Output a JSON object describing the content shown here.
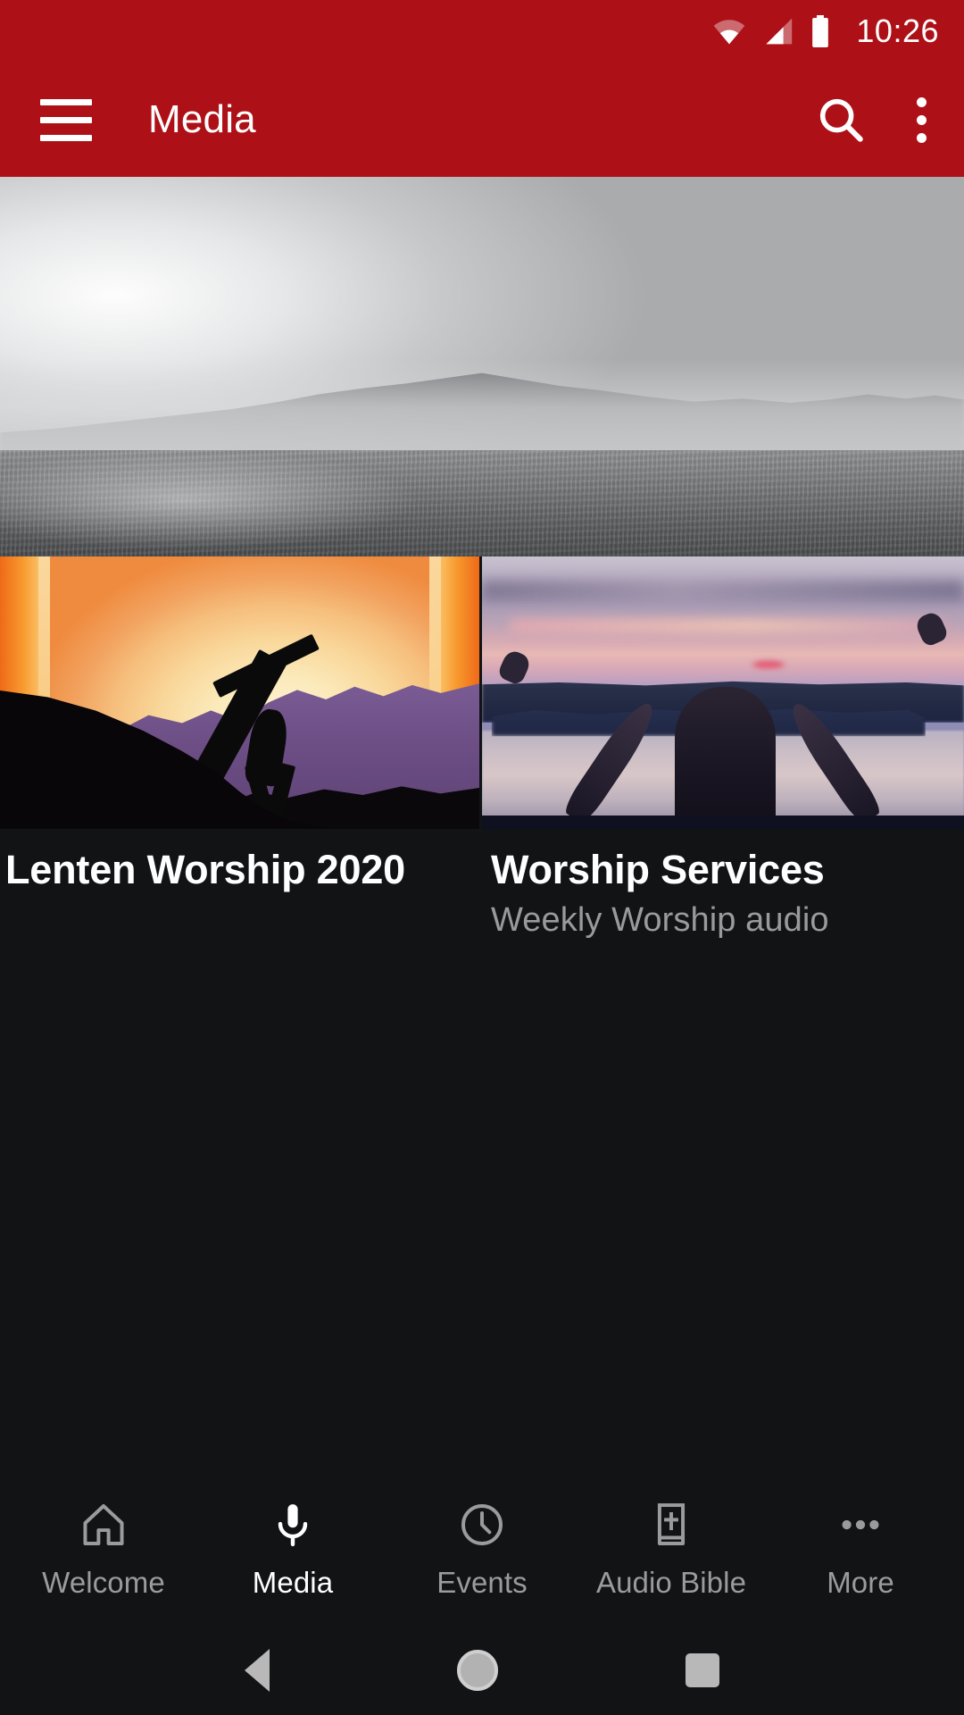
{
  "status_bar": {
    "time": "10:26",
    "wifi_icon": "wifi-icon",
    "signal_icon": "cellular-signal-icon",
    "battery_icon": "battery-full-icon"
  },
  "app_bar": {
    "menu_icon": "hamburger-menu-icon",
    "title": "Media",
    "search_icon": "search-icon",
    "overflow_icon": "overflow-menu-icon"
  },
  "hero": {
    "name": "hero-banner-image",
    "description": "Grayscale misty lake and mountain landscape"
  },
  "cards": [
    {
      "title": "Lenten Worship 2020",
      "subtitle": "",
      "image": "cross-silhouette-sunset-illustration"
    },
    {
      "title": "Worship Services",
      "subtitle": "Weekly Worship audio",
      "image": "woman-arms-raised-lake-sunset-photo"
    }
  ],
  "bottom_nav": {
    "items": [
      {
        "label": "Welcome",
        "icon": "home-icon",
        "active": false
      },
      {
        "label": "Media",
        "icon": "microphone-icon",
        "active": true
      },
      {
        "label": "Events",
        "icon": "clock-icon",
        "active": false
      },
      {
        "label": "Audio Bible",
        "icon": "bible-book-icon",
        "active": false
      },
      {
        "label": "More",
        "icon": "more-dots-icon",
        "active": false
      }
    ]
  },
  "system_nav": {
    "back": "back-button",
    "home": "home-button",
    "recent": "recent-apps-button"
  },
  "colors": {
    "accent_red": "#AD1117",
    "background": "#121315",
    "text_primary": "#FFFFFF",
    "text_secondary": "#9A9A9A"
  }
}
